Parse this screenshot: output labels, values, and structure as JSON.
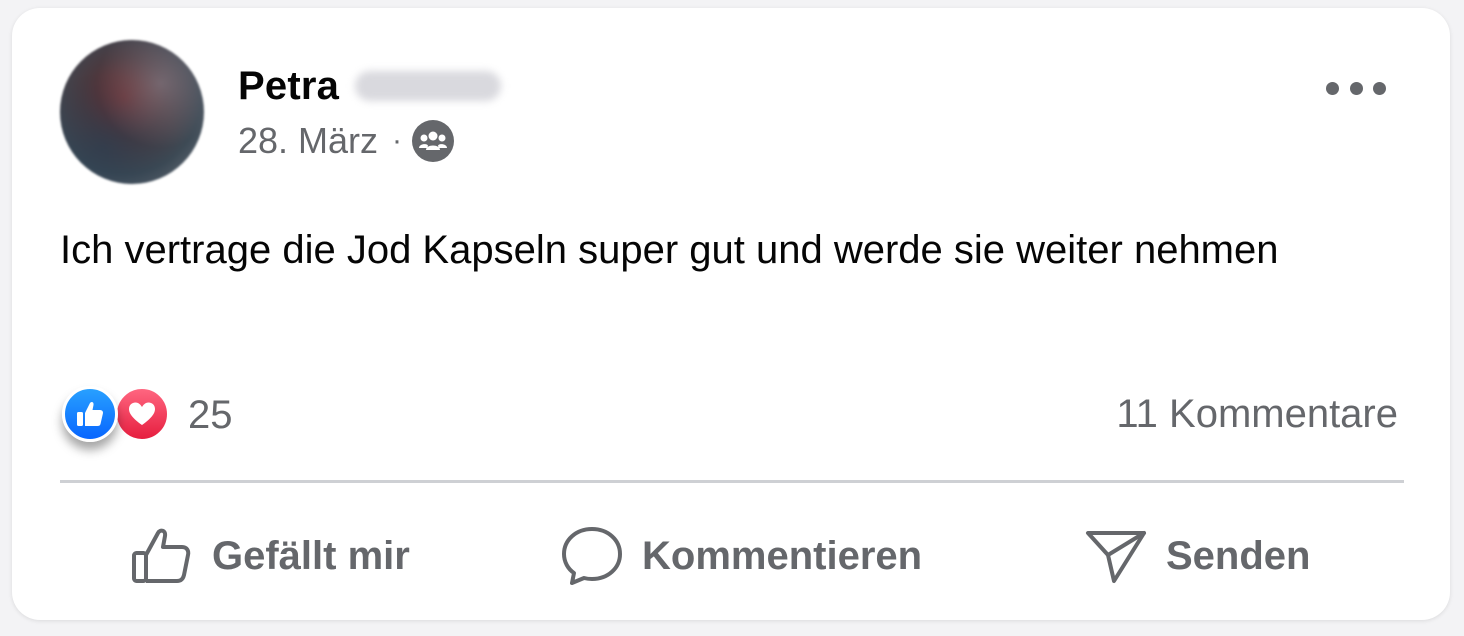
{
  "post": {
    "author_first_name": "Petra",
    "date": "28. März",
    "separator": "·",
    "audience_icon": "friends-icon",
    "body": "Ich vertrage die Jod Kapseln super gut und werde sie weiter nehmen",
    "reactions": {
      "types": [
        "like",
        "love"
      ],
      "count": "25"
    },
    "comments_count": "11 Kommentare"
  },
  "actions": {
    "like_label": "Gefällt mir",
    "comment_label": "Kommentieren",
    "send_label": "Senden"
  },
  "colors": {
    "text_primary": "#050505",
    "text_secondary": "#65676b",
    "like_blue": "#0866ff",
    "love_red": "#f02849",
    "divider": "#ced0d4"
  }
}
